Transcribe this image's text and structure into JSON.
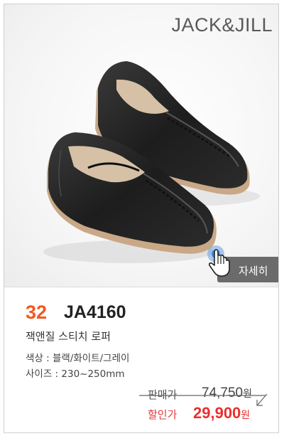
{
  "brand": "JACK&JILL",
  "detail_button": {
    "label": "자세히"
  },
  "product": {
    "number": "32",
    "code": "JA4160",
    "name": "잭앤질 스티치 로퍼",
    "color_spec": "색상 : 블랙/화이트/그레이",
    "size_spec": "사이즈 : 230~250mm"
  },
  "price": {
    "original_label": "판매가",
    "original_value": "74,750",
    "sale_label": "할인가",
    "sale_value": "29,900",
    "currency": "원"
  },
  "colors": {
    "accent_number": "#f0591f",
    "sale": "#ea2f2f",
    "button": "#6b6b6b"
  },
  "icons": [
    "hand-pointer-icon",
    "strike-arrow-icon"
  ]
}
